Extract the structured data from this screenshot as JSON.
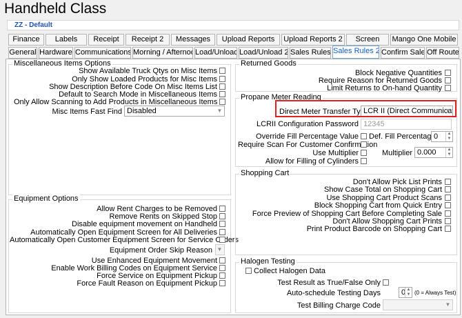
{
  "title": "Handheld Class",
  "subtitle": "ZZ - Default",
  "tabs_row1": [
    "Finance",
    "Labels",
    "Receipt",
    "Receipt 2",
    "Messages",
    "Upload Reports",
    "Upload Reports 2",
    "Screen",
    "Mango One Mobile"
  ],
  "tabs_row2": [
    "General",
    "Hardware",
    "Communications",
    "Morning / Afternoon",
    "Load/Unload",
    "Load/Unload 2",
    "Sales Rules",
    "Sales Rules 2",
    "Confirm Sale",
    "Off Route"
  ],
  "active_tab": "Sales Rules 2",
  "misc": {
    "title": "Miscellaneous Items Options",
    "items": [
      "Show Available Truck Qtys on Misc Items",
      "Only Show Loaded Products for Misc Items",
      "Show Description Before Code On Misc Items List",
      "Default to Search Mode in Miscellaneous Items",
      "Only Allow Scanning to Add Products in Miscellaneous Items"
    ],
    "fast_find_label": "Misc Items Fast Find",
    "fast_find_value": "Disabled"
  },
  "equipment": {
    "title": "Equipment Options",
    "items_top": [
      "Allow Rent Charges to be Removed",
      "Remove Rents on Skipped Stop",
      "Disable equipment movement on Handheld",
      "Automatically Open Equipment Screen for All Deliveries",
      "Automatically Open Customer Equipment Screen for Service Orders"
    ],
    "skip_reason_label": "Equipment Order Skip Reason",
    "skip_reason_value": "",
    "items_bottom": [
      "Use Enhanced Equipment Movement",
      "Enable Work Billing Codes on Equipment Service",
      "Force Service on Equipment Pickup",
      "Force Fault Reason on Equipment Pickup"
    ]
  },
  "returned": {
    "title": "Returned Goods",
    "items": [
      "Block Negative Quantities",
      "Require Reason for Returned Goods",
      "Limit Returns to On-hand Quantity"
    ]
  },
  "propane": {
    "title": "Propane Meter Reading",
    "transfer_label": "Direct Meter Transfer Type",
    "transfer_value": "LCR II (Direct Communicatio",
    "password_label": "LCRII Configuration Password",
    "password_value": "12345",
    "override_label": "Override Fill Percentage Value",
    "def_fill_label": "Def. Fill Percentage",
    "def_fill_value": "0",
    "scan_label": "Require Scan For Customer Confirmation",
    "multiplier_check_label": "Use Multiplier",
    "multiplier_label": "Multiplier",
    "multiplier_value": "0.000",
    "cylinders_label": "Allow for Filling of Cylinders"
  },
  "cart": {
    "title": "Shopping Cart",
    "items": [
      "Don't Allow Pick List Prints",
      "Show Case Total on Shopping Cart",
      "Use Shopping Cart Product Scans",
      "Block Shopping Cart from Quick Entry",
      "Force Preview of Shopping Cart Before Completing Sale",
      "Don't Allow Shopping Cart Prints",
      "Print Product Barcode on Shopping Cart"
    ]
  },
  "halogen": {
    "title": "Halogen Testing",
    "collect_label": "Collect Halogen Data",
    "result_label": "Test Result as True/False Only",
    "days_label": "Auto-schedule Testing Days",
    "days_value": "0",
    "days_hint": "(0 = Always Test)",
    "billing_label": "Test Billing Charge Code",
    "billing_value": ""
  },
  "colors": {
    "accent": "#1060c0",
    "highlight": "#e02020",
    "subtitle": "#2050b0"
  }
}
